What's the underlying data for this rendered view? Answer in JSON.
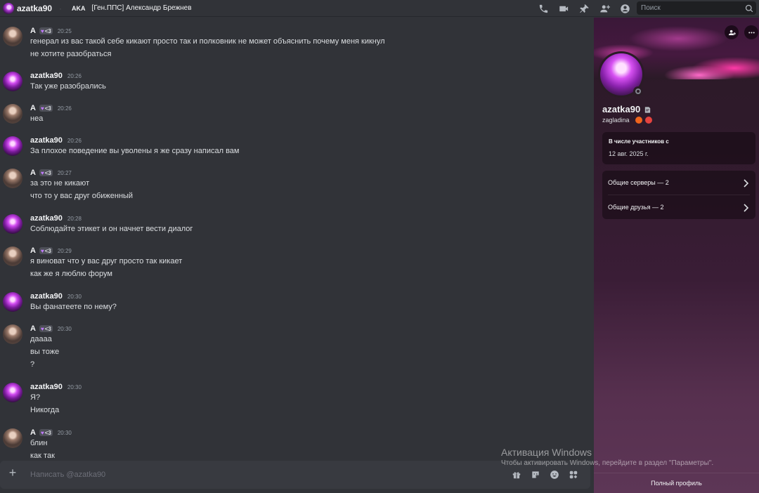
{
  "topbar": {
    "dm_name": "azatka90",
    "separator": "·",
    "tag": "AKA",
    "clan_name": "[Ген.ППС] Александр Брежнев",
    "search_placeholder": "Поиск",
    "icons": [
      "voice-call-icon",
      "video-call-icon",
      "pin-icon",
      "add-friends-to-dm-icon",
      "user-profile-icon"
    ]
  },
  "messages": [
    {
      "author": "А",
      "badge": "<3",
      "time": "20:25",
      "lines": [
        "генерал из вас такой себе кикают просто так и полковник не может объяснить почему меня кикнул",
        "не хотите разобраться"
      ]
    },
    {
      "author": "azatka90",
      "time": "20:26",
      "lines": [
        "Так уже разобрались"
      ]
    },
    {
      "author": "А",
      "badge": "<3",
      "time": "20:26",
      "lines": [
        "неа"
      ]
    },
    {
      "author": "azatka90",
      "time": "20:26",
      "lines": [
        "За плохое поведение вы уволены я же сразу написал вам"
      ]
    },
    {
      "author": "А",
      "badge": "<3",
      "time": "20:27",
      "lines": [
        "за это не кикают",
        "что то у вас друг обиженный"
      ]
    },
    {
      "author": "azatka90",
      "time": "20:28",
      "lines": [
        "Соблюдайте этикет и он начнет вести диалог"
      ]
    },
    {
      "author": "А",
      "badge": "<3",
      "time": "20:29",
      "lines": [
        "я виноват что  у вас друг просто так кикает",
        "как же я люблю форум"
      ]
    },
    {
      "author": "azatka90",
      "time": "20:30",
      "lines": [
        "Вы фанатеете по нему?"
      ]
    },
    {
      "author": "А",
      "badge": "<3",
      "time": "20:30",
      "lines": [
        "даааа",
        "вы тоже",
        "?"
      ]
    },
    {
      "author": "azatka90",
      "time": "20:30",
      "lines": [
        "Я?",
        "Никогда"
      ]
    },
    {
      "author": "А",
      "badge": "<3",
      "time": "20:30",
      "lines": [
        "блин",
        "как так"
      ]
    }
  ],
  "composer": {
    "placeholder": "Написать @azatka90",
    "tools": [
      "gift-icon",
      "gif-icon",
      "sticker-icon",
      "emoji-icon",
      "apps-icon"
    ]
  },
  "profile": {
    "display_name": "azatka90",
    "username": "zagladina",
    "member_since_title": "В числе участников с",
    "member_since_date": "12 авг. 2025 г.",
    "mutual_servers": "Общие серверы — 2",
    "mutual_friends": "Общие друзья — 2",
    "full_profile": "Полный профиль",
    "status": "offline"
  },
  "watermark": {
    "title": "Активация Windows",
    "text": "Чтобы активировать Windows, перейдите в раздел \"Параметры\"."
  },
  "colors": {
    "background": "#313338",
    "composer": "#383a40",
    "text": "#dbdee1",
    "muted": "#949ba4",
    "badge_heart": "#c27bff"
  }
}
